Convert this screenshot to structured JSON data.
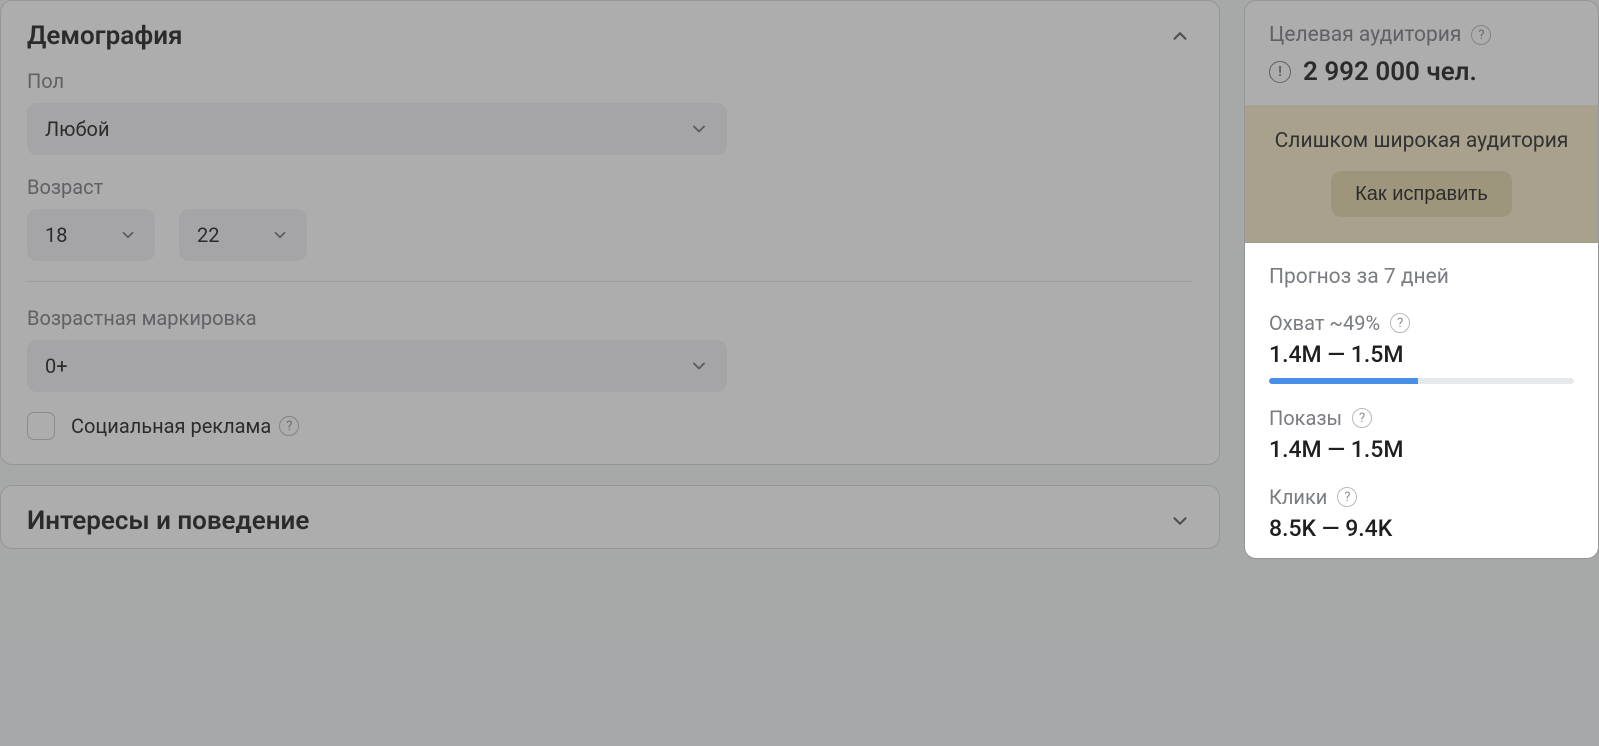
{
  "demographics": {
    "title": "Демография",
    "gender_label": "Пол",
    "gender_value": "Любой",
    "age_label": "Возраст",
    "age_from": "18",
    "age_to": "22",
    "age_marking_label": "Возрастная маркировка",
    "age_marking_value": "0+",
    "social_ad_label": "Социальная реклама"
  },
  "interests": {
    "title": "Интересы и поведение"
  },
  "sidebar": {
    "audience_label": "Целевая аудитория",
    "audience_count": "2 992 000 чел.",
    "warn_text": "Слишком широкая аудитория",
    "warn_button": "Как исправить",
    "forecast_title": "Прогноз за 7 дней",
    "reach_label": "Охват ~49%",
    "reach_value": "1.4M — 1.5M",
    "reach_progress_pct": 49,
    "impressions_label": "Показы",
    "impressions_value": "1.4M — 1.5M",
    "clicks_label": "Клики",
    "clicks_value": "8.5K — 9.4K"
  }
}
